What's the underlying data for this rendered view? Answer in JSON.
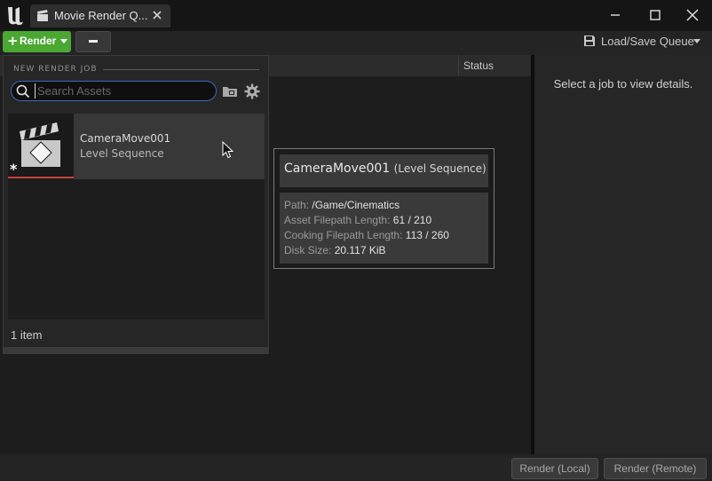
{
  "window": {
    "tab_title": "Movie Render Q...",
    "controls": [
      "minimize-icon",
      "maximize-icon",
      "close-icon"
    ]
  },
  "toolbar": {
    "render_label": "Render",
    "load_save_label": "Load/Save Queue"
  },
  "queue": {
    "status_header": "Status"
  },
  "details": {
    "hint": "Select a job to view details."
  },
  "footer": {
    "render_local": "Render (Local)",
    "render_remote": "Render (Remote)"
  },
  "dropdown": {
    "section_title": "NEW RENDER JOB",
    "search_placeholder": "Search Assets",
    "search_value": "",
    "assets": [
      {
        "name": "CameraMove001",
        "type": "Level Sequence"
      }
    ],
    "item_count": "1 item"
  },
  "tooltip": {
    "name": "CameraMove001",
    "type": "(Level Sequence)",
    "rows": [
      {
        "key": "Path:",
        "value": "/Game/Cinematics"
      },
      {
        "key": "Asset Filepath Length:",
        "value": "61 / 210"
      },
      {
        "key": "Cooking Filepath Length:",
        "value": "113 / 260"
      },
      {
        "key": "Disk Size:",
        "value": "20.117 KiB"
      }
    ]
  },
  "colors": {
    "render_green": "#4aa832",
    "search_focus": "#3a6bb8",
    "dirty_bar": "#c9413f"
  }
}
